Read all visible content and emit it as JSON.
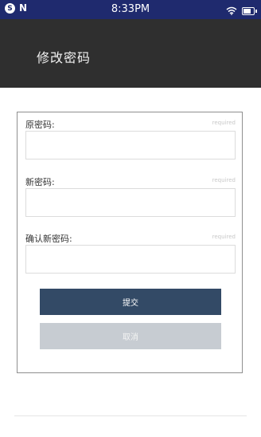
{
  "status_bar": {
    "time": "8:33PM",
    "s_icon": "S",
    "n_icon": "N"
  },
  "header": {
    "title": "修改密码"
  },
  "form": {
    "fields": [
      {
        "label": "原密码:",
        "required": "required",
        "value": ""
      },
      {
        "label": "新密码:",
        "required": "required",
        "value": ""
      },
      {
        "label": "确认新密码:",
        "required": "required",
        "value": ""
      }
    ],
    "submit_label": "提交",
    "cancel_label": "取消"
  },
  "colors": {
    "status_bar": "#1f2a6e",
    "header": "#2f2f2f",
    "submit": "#334a66",
    "cancel": "#c7ccd2"
  }
}
